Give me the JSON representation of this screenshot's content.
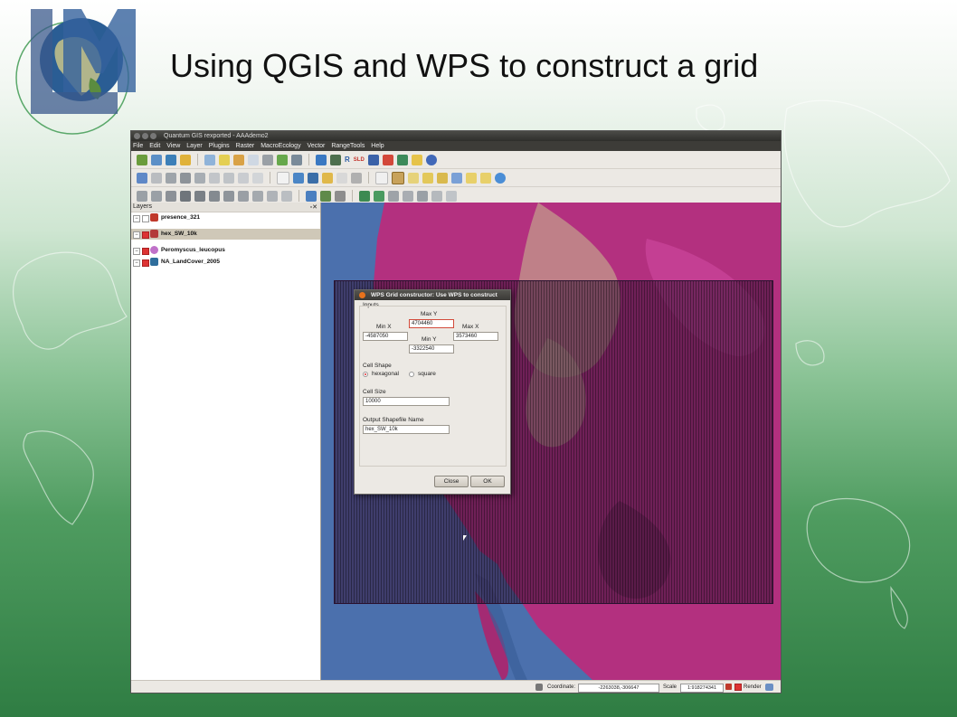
{
  "slide": {
    "title": "Using QGIS and WPS to construct a grid",
    "logo_text": "LM"
  },
  "qgis": {
    "window_title": "Quantum GIS rexported - AAAdemo2",
    "menu": [
      "File",
      "Edit",
      "View",
      "Layer",
      "Plugins",
      "Raster",
      "MacroEcology",
      "Vector",
      "RangeTools",
      "Help"
    ],
    "toolbar_sld_label": "SLD",
    "toolbar_r_label": "R",
    "layers_panel": {
      "title": "Layers",
      "items": [
        {
          "name": "presence_321",
          "checked": false,
          "selected": false,
          "icon": "polygon-layer-icon"
        },
        {
          "name": "hex_SW_10k",
          "checked": true,
          "selected": true,
          "icon": "polygon-layer-icon"
        },
        {
          "name": "Peromyscus_leucopus",
          "checked": true,
          "selected": false,
          "icon": "point-layer-icon"
        },
        {
          "name": "NA_LandCover_2005",
          "checked": true,
          "selected": false,
          "icon": "raster-layer-icon"
        }
      ]
    },
    "status": {
      "coordinate_label": "Coordinate:",
      "coordinate_value": "-2263038,-306647",
      "scale_label": "Scale",
      "scale_value": "1:918274341",
      "render_label": "Render"
    }
  },
  "dialog": {
    "title": "WPS Grid constructor: Use WPS to construct",
    "inputs_label": "Inputs",
    "max_y_label": "Max Y",
    "max_y_value": "4704460",
    "min_x_label": "Min X",
    "min_x_value": "-4587050",
    "max_x_label": "Max X",
    "max_x_value": "3573460",
    "min_y_label": "Min Y",
    "min_y_value": "-3322540",
    "cell_shape_label": "Cell Shape",
    "shape_options": [
      "hexagonal",
      "square"
    ],
    "shape_selected": "hexagonal",
    "cell_size_label": "Cell Size",
    "cell_size_value": "10000",
    "output_label": "Output Shapefile Name",
    "output_value": "hex_SW_10k",
    "close_button": "Close",
    "ok_button": "OK"
  },
  "colors": {
    "map_ocean": "#4a6fae",
    "map_land": "#b0307f",
    "grid_overlay": "#371437",
    "accent_red": "#d33333"
  }
}
